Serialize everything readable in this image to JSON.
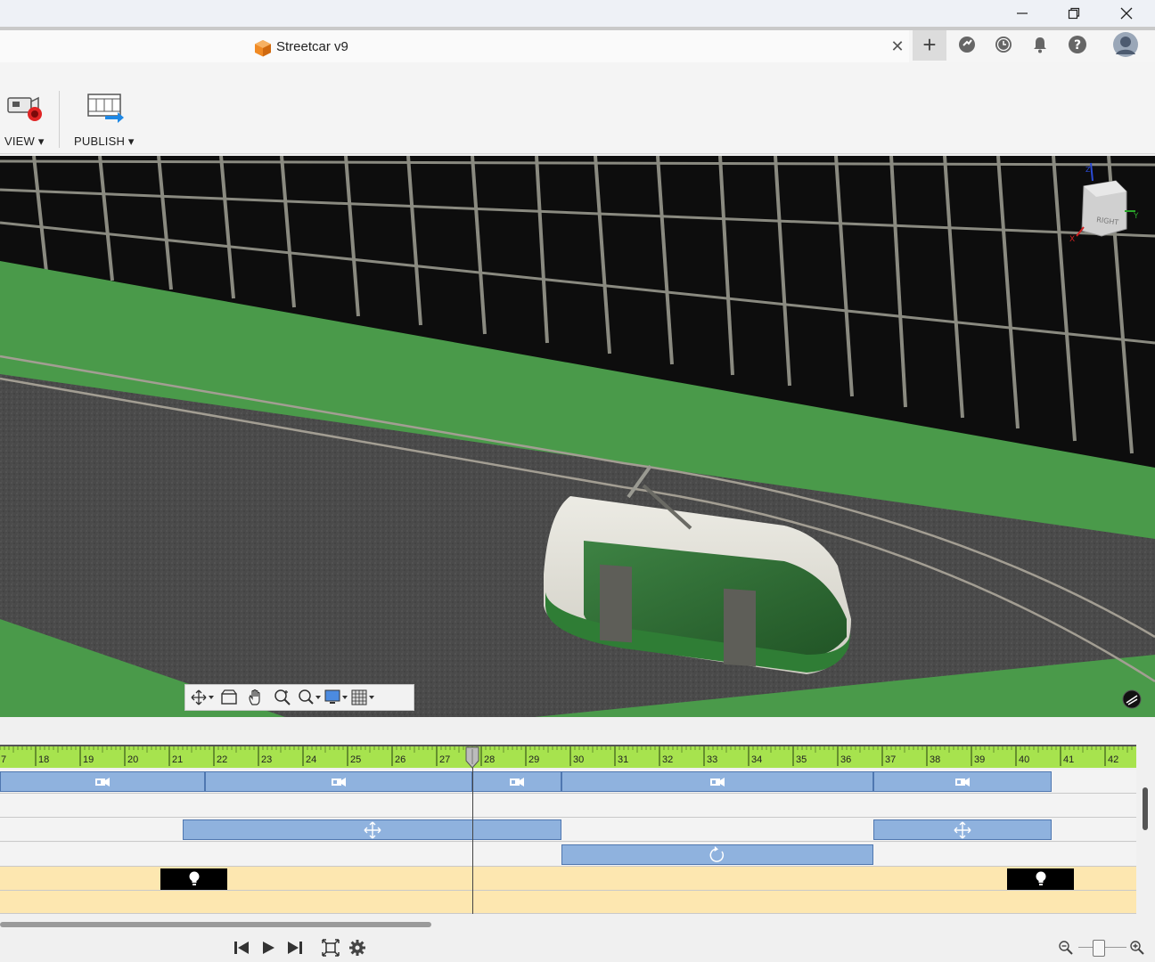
{
  "window": {
    "minimize_icon": "minimize-icon",
    "restore_icon": "restore-icon",
    "close_icon": "close-icon"
  },
  "tab": {
    "title": "Streetcar v9",
    "close_glyph": "✕",
    "new_tab_glyph": "+"
  },
  "toolbar": {
    "view_label": "VIEW",
    "publish_label": "PUBLISH"
  },
  "viewcube": {
    "face": "RIGHT",
    "axis_x": "X",
    "axis_y": "Y",
    "axis_z": "Z"
  },
  "timeline": {
    "ruler_ticks": [
      "7",
      "18",
      "19",
      "20",
      "21",
      "22",
      "23",
      "24",
      "25",
      "26",
      "27",
      "28",
      "29",
      "30",
      "31",
      "32",
      "33",
      "34",
      "35",
      "36",
      "37",
      "38",
      "39",
      "40",
      "41",
      "42"
    ],
    "playhead": 27.8,
    "camera_clips": [
      [
        16.8,
        21.8
      ],
      [
        21.8,
        27.8
      ],
      [
        27.8,
        29.8
      ],
      [
        29.8,
        36.8
      ],
      [
        36.8,
        40.8
      ]
    ],
    "move_clips": [
      [
        21.3,
        29.8
      ],
      [
        36.8,
        40.8
      ]
    ],
    "rotate_clips": [
      [
        29.8,
        36.8
      ]
    ],
    "light_markers": [
      [
        20.8,
        22.3
      ],
      [
        39.8,
        41.3
      ]
    ]
  },
  "colors": {
    "accent_orange": "#f08a24",
    "ruler_green": "#a7e34e",
    "clip_blue": "#8fb2de",
    "light_track": "#fde7b0",
    "ground_green": "#4a9a4a"
  }
}
